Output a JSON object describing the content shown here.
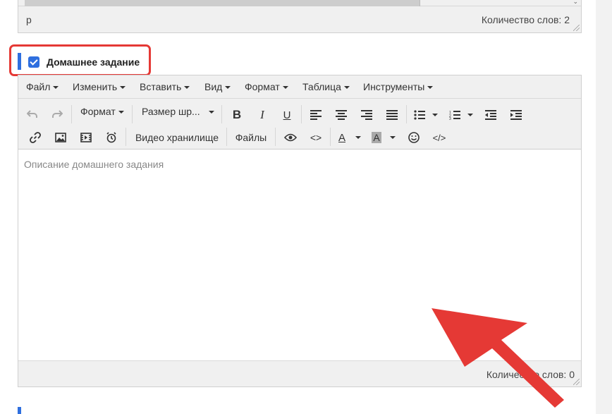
{
  "prev_editor": {
    "status_path": "p",
    "word_count": "Количество слов: 2"
  },
  "section": {
    "title": "Домашнее задание",
    "checked": true
  },
  "menubar": {
    "file": "Файл",
    "edit": "Изменить",
    "insert": "Вставить",
    "view": "Вид",
    "format": "Формат",
    "table": "Таблица",
    "tools": "Инструменты"
  },
  "toolbar": {
    "format_dropdown": "Формат",
    "font_size_dropdown": "Размер шр...",
    "bold": "B",
    "italic": "I",
    "underline": "U",
    "text_color": "A",
    "bg_color": "A",
    "video_storage": "Видео хранилище",
    "files": "Файлы",
    "source_code": "</>",
    "code": "<>"
  },
  "editor": {
    "placeholder": "Описание домашнего задания",
    "word_count": "Количество слов: 0"
  },
  "colors": {
    "accent": "#2f6fdf",
    "highlight": "#e53935"
  }
}
